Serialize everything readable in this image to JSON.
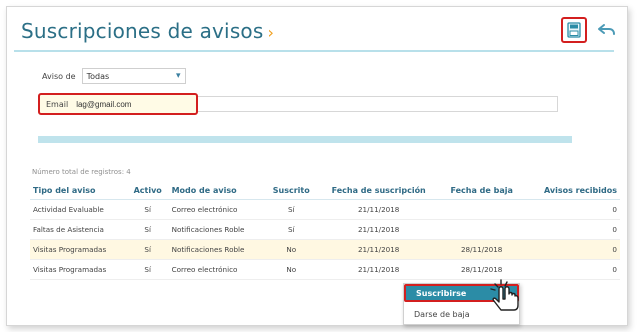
{
  "page": {
    "title": "Suscripciones de avisos",
    "title_chevron": "›"
  },
  "toolbar": {
    "save_icon": "save-icon",
    "undo_icon": "undo-icon",
    "accent": "#d31f1f"
  },
  "filters": {
    "aviso_label": "Aviso de",
    "aviso_selected": "Todas",
    "email_label": "Email",
    "email_value": "lag@gmail.com"
  },
  "table": {
    "total_label": "Número total de registros: 4",
    "headers": [
      "Tipo del aviso",
      "Activo",
      "Modo de aviso",
      "Suscrito",
      "Fecha de suscripción",
      "Fecha de baja",
      "Avisos recibidos"
    ],
    "rows": [
      [
        "Actividad Evaluable",
        "Sí",
        "Correo electrónico",
        "Sí",
        "21/11/2018",
        "",
        "0"
      ],
      [
        "Faltas de Asistencia",
        "Sí",
        "Notificaciones Roble",
        "Sí",
        "21/11/2018",
        "",
        "0"
      ],
      [
        "Visitas Programadas",
        "Sí",
        "Notificaciones Roble",
        "No",
        "21/11/2018",
        "28/11/2018",
        "0"
      ],
      [
        "Visitas Programadas",
        "Sí",
        "Correo electrónico",
        "No",
        "21/11/2018",
        "28/11/2018",
        "0"
      ]
    ]
  },
  "context_menu": {
    "subscribe_label": "Suscribirse",
    "unsubscribe_label": "Darse de baja"
  },
  "colors": {
    "title": "#2b6f86",
    "primary": "#2b8ca6",
    "highlight_row": "#fff8e2",
    "bar": "#bfe3ec"
  }
}
